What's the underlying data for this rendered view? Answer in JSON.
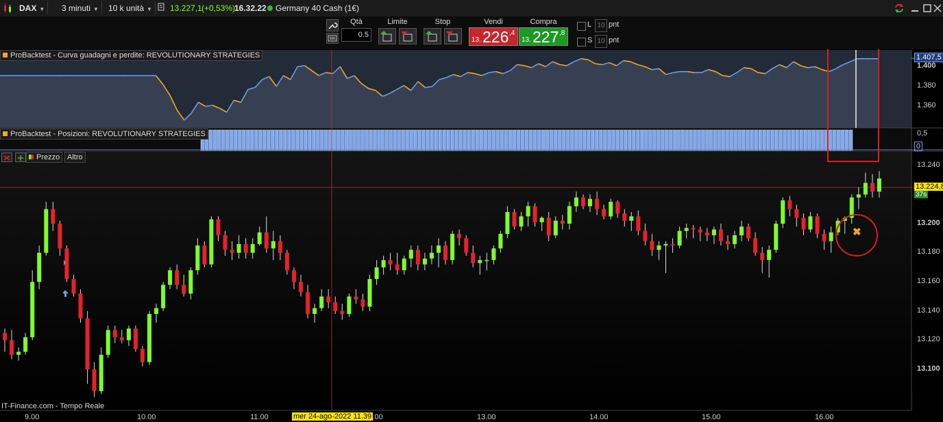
{
  "toolbar": {
    "symbol": "DAX",
    "timeframe": "3 minuti",
    "units": "10 k unità",
    "last_price": "13.227,1",
    "change": "(+0,53%)",
    "time": "16.32.22",
    "instrument": "Germany 40 Cash (1€)"
  },
  "order": {
    "qty_label": "Qtà",
    "qty_value": "0.5",
    "limit_label": "Limite",
    "stop_label": "Stop",
    "sell_label": "Vendi",
    "buy_label": "Compra",
    "sell_prefix": "13.",
    "sell_main": "226",
    "sell_suffix": ",4",
    "buy_prefix": "13.",
    "buy_main": "227",
    "buy_suffix": ",8",
    "l_label": "L",
    "s_label": "S",
    "l_value": "10",
    "s_value": "10",
    "pnt1": "pnt",
    "pnt2": "pnt"
  },
  "panels": {
    "equity_title": "ProBacktest - Curva guadagni e perdite: REVOLUTIONARY  STRATEGIES",
    "positions_title": "ProBacktest - Posizioni: REVOLUTIONARY  STRATEGIES",
    "price_tab": "Prezzo",
    "other_tab": "Altro"
  },
  "equity_axis": {
    "current": "1.407,5",
    "ticks": [
      "1.400",
      "1.380",
      "1.360"
    ]
  },
  "positions_axis": {
    "ticks": [
      "0,5",
      "0"
    ]
  },
  "price_axis": {
    "current": "13.224,8",
    "countdown": "37s",
    "ticks": [
      "13.240",
      "13.220",
      "13.200",
      "13.180",
      "13.160",
      "13.140",
      "13.120",
      "13.100"
    ]
  },
  "time_axis": {
    "ticks": [
      "9.00",
      "10.00",
      "11.00",
      "11.00",
      "13.00",
      "14.00",
      "15.00",
      "16.00"
    ],
    "cursor_label": "mer 24-ago-2022 11.39"
  },
  "footer": {
    "source": "IT-Finance.com - Tempo Reale"
  },
  "colors": {
    "up": "#7dff2a",
    "down": "#e8202a",
    "equity_up": "#6b9de8",
    "equity_down": "#f5a623",
    "highlight": "#e21b1b"
  },
  "chart_data": {
    "type": "candlestick",
    "equity_series": [
      1.39,
      1.39,
      1.39,
      1.39,
      1.39,
      1.39,
      1.39,
      1.39,
      1.39,
      1.39,
      1.39,
      1.39,
      1.39,
      1.39,
      1.39,
      1.39,
      1.39,
      1.39,
      1.39,
      1.39,
      1.39,
      1.39,
      1.39,
      1.381,
      1.37,
      1.355,
      1.345,
      1.352,
      1.363,
      1.359,
      1.36,
      1.357,
      1.353,
      1.365,
      1.363,
      1.376,
      1.378,
      1.386,
      1.389,
      1.379,
      1.39,
      1.386,
      1.399,
      1.4,
      1.395,
      1.39,
      1.393,
      1.392,
      1.399,
      1.387,
      1.39,
      1.382,
      1.377,
      1.375,
      1.369,
      1.372,
      1.376,
      1.38,
      1.375,
      1.384,
      1.378,
      1.379,
      1.386,
      1.388,
      1.391,
      1.389,
      1.393,
      1.392,
      1.39,
      1.393,
      1.394,
      1.392,
      1.395,
      1.401,
      1.4,
      1.398,
      1.402,
      1.399,
      1.404,
      1.401,
      1.4,
      1.404,
      1.407,
      1.406,
      1.402,
      1.401,
      1.403,
      1.4,
      1.405,
      1.404,
      1.401,
      1.399,
      1.396,
      1.397,
      1.391,
      1.393,
      1.394,
      1.394,
      1.393,
      1.393,
      1.396,
      1.394,
      1.39,
      1.389,
      1.393,
      1.398,
      1.397,
      1.393,
      1.392,
      1.397,
      1.401,
      1.398,
      1.404,
      1.4,
      1.398,
      1.399,
      1.396,
      1.394,
      1.397,
      1.401,
      1.404,
      1.407,
      1.407,
      1.407,
      1.407
    ],
    "candles": [
      [
        13125,
        13128,
        13112,
        13120
      ],
      [
        13120,
        13127,
        13107,
        13110
      ],
      [
        13110,
        13115,
        13106,
        13112
      ],
      [
        13112,
        13125,
        13110,
        13122
      ],
      [
        13122,
        13168,
        13120,
        13160
      ],
      [
        13160,
        13185,
        13155,
        13180
      ],
      [
        13180,
        13215,
        13178,
        13210
      ],
      [
        13210,
        13215,
        13195,
        13200
      ],
      [
        13200,
        13202,
        13178,
        13183
      ],
      [
        13183,
        13185,
        13160,
        13162
      ],
      [
        13162,
        13165,
        13150,
        13152
      ],
      [
        13152,
        13155,
        13132,
        13135
      ],
      [
        13135,
        13140,
        13090,
        13100
      ],
      [
        13100,
        13105,
        13081,
        13085
      ],
      [
        13085,
        13115,
        13083,
        13110
      ],
      [
        13110,
        13130,
        13108,
        13127
      ],
      [
        13127,
        13130,
        13118,
        13122
      ],
      [
        13122,
        13127,
        13118,
        13120
      ],
      [
        13120,
        13130,
        13116,
        13128
      ],
      [
        13128,
        13130,
        13112,
        13114
      ],
      [
        13114,
        13116,
        13102,
        13105
      ],
      [
        13105,
        13140,
        13103,
        13138
      ],
      [
        13138,
        13145,
        13132,
        13142
      ],
      [
        13142,
        13160,
        13140,
        13158
      ],
      [
        13158,
        13170,
        13155,
        13168
      ],
      [
        13168,
        13172,
        13155,
        13158
      ],
      [
        13158,
        13165,
        13150,
        13152
      ],
      [
        13152,
        13170,
        13148,
        13168
      ],
      [
        13168,
        13190,
        13165,
        13185
      ],
      [
        13185,
        13188,
        13170,
        13172
      ],
      [
        13172,
        13205,
        13170,
        13203
      ],
      [
        13203,
        13205,
        13188,
        13192
      ],
      [
        13192,
        13195,
        13178,
        13182
      ],
      [
        13182,
        13188,
        13175,
        13180
      ],
      [
        13180,
        13192,
        13176,
        13186
      ],
      [
        13186,
        13190,
        13176,
        13180
      ],
      [
        13180,
        13190,
        13176,
        13186
      ],
      [
        13186,
        13198,
        13185,
        13194
      ],
      [
        13194,
        13205,
        13180,
        13183
      ],
      [
        13183,
        13195,
        13175,
        13188
      ],
      [
        13188,
        13192,
        13175,
        13180
      ],
      [
        13180,
        13182,
        13165,
        13168
      ],
      [
        13168,
        13170,
        13155,
        13160
      ],
      [
        13160,
        13165,
        13150,
        13153
      ],
      [
        13153,
        13158,
        13135,
        13138
      ],
      [
        13138,
        13145,
        13132,
        13142
      ],
      [
        13142,
        13155,
        13140,
        13150
      ],
      [
        13150,
        13155,
        13142,
        13146
      ],
      [
        13146,
        13150,
        13138,
        13140
      ],
      [
        13140,
        13145,
        13134,
        13138
      ],
      [
        13138,
        13152,
        13136,
        13150
      ],
      [
        13150,
        13155,
        13145,
        13148
      ],
      [
        13148,
        13152,
        13140,
        13143
      ],
      [
        13143,
        13165,
        13140,
        13162
      ],
      [
        13162,
        13175,
        13158,
        13170
      ],
      [
        13170,
        13178,
        13165,
        13175
      ],
      [
        13175,
        13180,
        13168,
        13172
      ],
      [
        13172,
        13180,
        13165,
        13168
      ],
      [
        13168,
        13178,
        13165,
        13176
      ],
      [
        13176,
        13185,
        13170,
        13182
      ],
      [
        13182,
        13185,
        13168,
        13172
      ],
      [
        13172,
        13180,
        13168,
        13176
      ],
      [
        13176,
        13185,
        13172,
        13180
      ],
      [
        13180,
        13190,
        13170,
        13185
      ],
      [
        13185,
        13188,
        13172,
        13175
      ],
      [
        13175,
        13195,
        13172,
        13193
      ],
      [
        13193,
        13196,
        13185,
        13190
      ],
      [
        13190,
        13192,
        13178,
        13180
      ],
      [
        13180,
        13185,
        13170,
        13173
      ],
      [
        13173,
        13178,
        13165,
        13175
      ],
      [
        13175,
        13180,
        13168,
        13175
      ],
      [
        13175,
        13185,
        13172,
        13183
      ],
      [
        13183,
        13195,
        13180,
        13193
      ],
      [
        13193,
        13212,
        13190,
        13208
      ],
      [
        13208,
        13210,
        13196,
        13198
      ],
      [
        13198,
        13208,
        13195,
        13205
      ],
      [
        13205,
        13215,
        13198,
        13212
      ],
      [
        13212,
        13214,
        13198,
        13201
      ],
      [
        13201,
        13205,
        13195,
        13204
      ],
      [
        13204,
        13208,
        13188,
        13192
      ],
      [
        13192,
        13205,
        13190,
        13202
      ],
      [
        13202,
        13206,
        13196,
        13200
      ],
      [
        13200,
        13215,
        13196,
        13212
      ],
      [
        13212,
        13222,
        13208,
        13218
      ],
      [
        13218,
        13220,
        13210,
        13212
      ],
      [
        13212,
        13220,
        13208,
        13217
      ],
      [
        13217,
        13222,
        13206,
        13210
      ],
      [
        13210,
        13213,
        13203,
        13205
      ],
      [
        13205,
        13217,
        13203,
        13215
      ],
      [
        13215,
        13216,
        13204,
        13207
      ],
      [
        13207,
        13210,
        13198,
        13202
      ],
      [
        13202,
        13208,
        13195,
        13205
      ],
      [
        13205,
        13209,
        13192,
        13195
      ],
      [
        13195,
        13200,
        13185,
        13188
      ],
      [
        13188,
        13193,
        13178,
        13182
      ],
      [
        13182,
        13188,
        13175,
        13185
      ],
      [
        13185,
        13188,
        13166,
        13186
      ],
      [
        13186,
        13190,
        13180,
        13185
      ],
      [
        13185,
        13198,
        13183,
        13195
      ],
      [
        13195,
        13200,
        13190,
        13197
      ],
      [
        13197,
        13199,
        13190,
        13196
      ],
      [
        13196,
        13198,
        13188,
        13194
      ],
      [
        13194,
        13197,
        13188,
        13192
      ],
      [
        13192,
        13198,
        13186,
        13196
      ],
      [
        13196,
        13200,
        13185,
        13188
      ],
      [
        13188,
        13192,
        13182,
        13186
      ],
      [
        13186,
        13195,
        13183,
        13192
      ],
      [
        13192,
        13202,
        13188,
        13198
      ],
      [
        13198,
        13200,
        13188,
        13190
      ],
      [
        13190,
        13194,
        13178,
        13180
      ],
      [
        13180,
        13184,
        13166,
        13175
      ],
      [
        13175,
        13185,
        13163,
        13182
      ],
      [
        13182,
        13202,
        13180,
        13200
      ],
      [
        13200,
        13218,
        13197,
        13216
      ],
      [
        13216,
        13219,
        13205,
        13210
      ],
      [
        13210,
        13213,
        13198,
        13204
      ],
      [
        13204,
        13207,
        13192,
        13196
      ],
      [
        13196,
        13208,
        13194,
        13205
      ],
      [
        13205,
        13207,
        13190,
        13193
      ],
      [
        13193,
        13196,
        13182,
        13188
      ],
      [
        13188,
        13198,
        13180,
        13194
      ],
      [
        13194,
        13204,
        13192,
        13202
      ],
      [
        13202,
        13205,
        13193,
        13204
      ],
      [
        13204,
        13220,
        13200,
        13218
      ],
      [
        13218,
        13225,
        13210,
        13220
      ],
      [
        13220,
        13235,
        13218,
        13228
      ],
      [
        13228,
        13234,
        13218,
        13222
      ],
      [
        13222,
        13236,
        13218,
        13231
      ]
    ]
  }
}
